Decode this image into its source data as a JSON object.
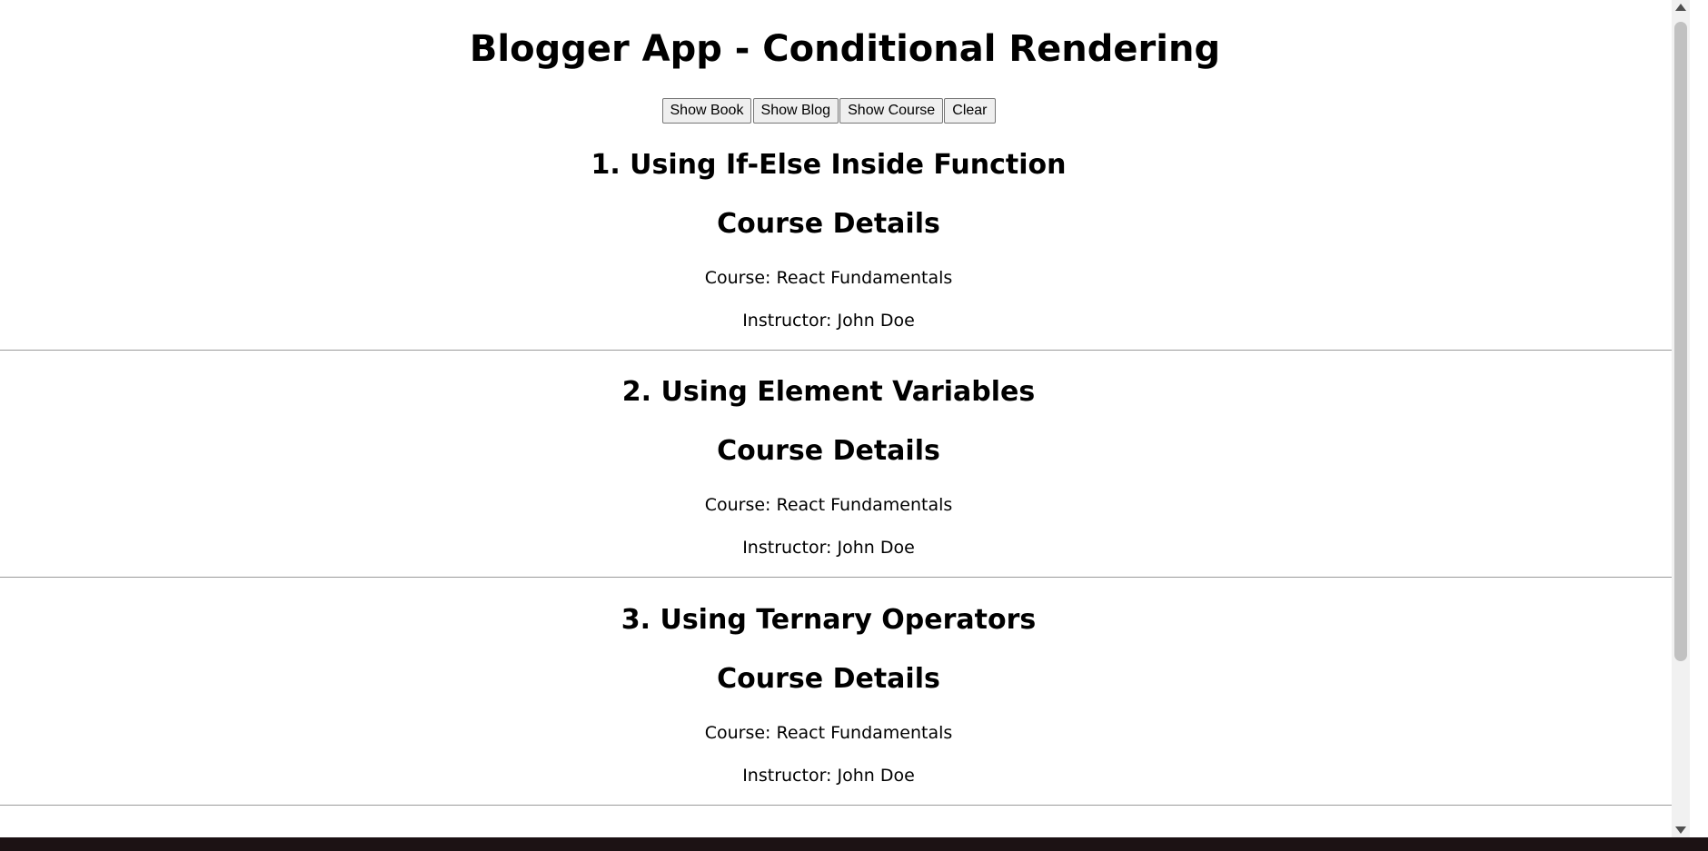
{
  "app": {
    "title": "Blogger App - Conditional Rendering"
  },
  "toolbar": {
    "buttons": [
      {
        "label": "Show Book"
      },
      {
        "label": "Show Blog"
      },
      {
        "label": "Show Course"
      },
      {
        "label": "Clear"
      }
    ]
  },
  "sections": [
    {
      "title": "1. Using If-Else Inside Function",
      "heading": "Course Details",
      "course_line": "Course: React Fundamentals",
      "instructor_line": "Instructor: John Doe"
    },
    {
      "title": "2. Using Element Variables",
      "heading": "Course Details",
      "course_line": "Course: React Fundamentals",
      "instructor_line": "Instructor: John Doe"
    },
    {
      "title": "3. Using Ternary Operators",
      "heading": "Course Details",
      "course_line": "Course: React Fundamentals",
      "instructor_line": "Instructor: John Doe"
    }
  ],
  "colors": {
    "background": "#ffffff",
    "text": "#000000",
    "divider": "#9a9a9a",
    "button_bg": "#efefef",
    "taskbar": "#1c1214"
  }
}
